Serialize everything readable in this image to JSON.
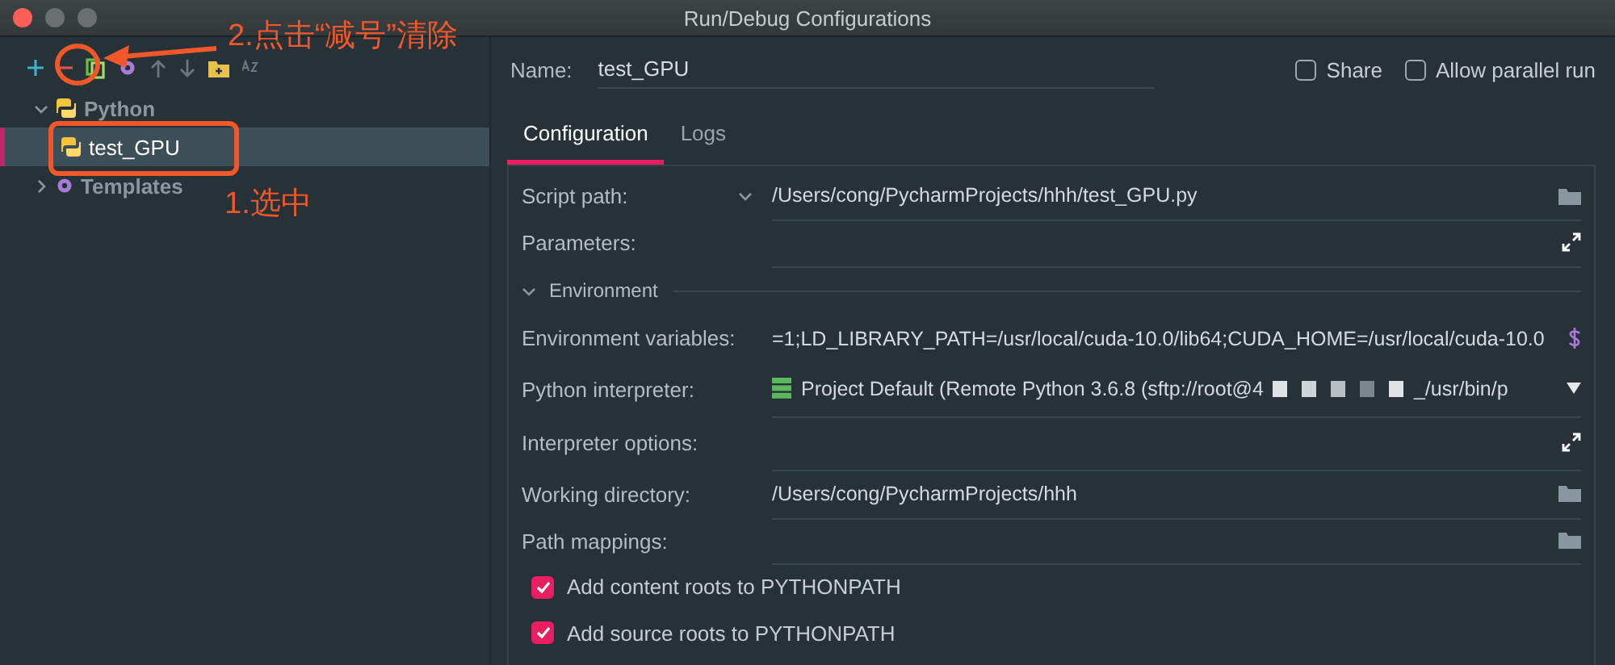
{
  "window": {
    "title": "Run/Debug Configurations"
  },
  "tree": [
    {
      "label": "Python",
      "expanded": true,
      "selected": false,
      "children": [
        {
          "label": "test_GPU",
          "selected": true
        }
      ]
    },
    {
      "label": "Templates",
      "expanded": false,
      "selected": false
    }
  ],
  "name_field": {
    "label": "Name:",
    "value": "test_GPU"
  },
  "options": [
    {
      "label": "Share",
      "checked": false
    },
    {
      "label": "Allow parallel run",
      "checked": false
    }
  ],
  "tabs": [
    {
      "label": "Configuration",
      "selected": true
    },
    {
      "label": "Logs",
      "selected": false
    }
  ],
  "rows": [
    {
      "kind": "file",
      "label": "Script path:",
      "value": "/Users/cong/PycharmProjects/hhh/test_GPU.py"
    },
    {
      "kind": "expand",
      "label": "Parameters:"
    },
    {
      "kind": "section",
      "label": "Environment",
      "expanded": true
    },
    {
      "kind": "env",
      "label": "Environment variables:",
      "value": "=1;LD_LIBRARY_PATH=/usr/local/cuda-10.0/lib64;CUDA_HOME=/usr/local/cuda-10.0"
    },
    {
      "kind": "interpreter",
      "label": "Python interpreter:",
      "value": "Project Default (Remote Python 3.6.8 (sftp://root@4",
      "value_end": "_/usr/bin/p"
    },
    {
      "kind": "expand",
      "label": "Interpreter options:"
    },
    {
      "kind": "folder",
      "label": "Working directory:",
      "value": "/Users/cong/PycharmProjects/hhh"
    },
    {
      "kind": "folder",
      "label": "Path mappings:"
    },
    {
      "kind": "check",
      "label": "Add content roots to PYTHONPATH",
      "checked": true
    },
    {
      "kind": "check",
      "label": "Add source roots to PYTHONPATH",
      "checked": true
    }
  ],
  "annotations": [
    {
      "kind": "arrow",
      "text": "2.点击“减号”清除"
    },
    {
      "kind": "select",
      "text": "1.选中"
    }
  ]
}
